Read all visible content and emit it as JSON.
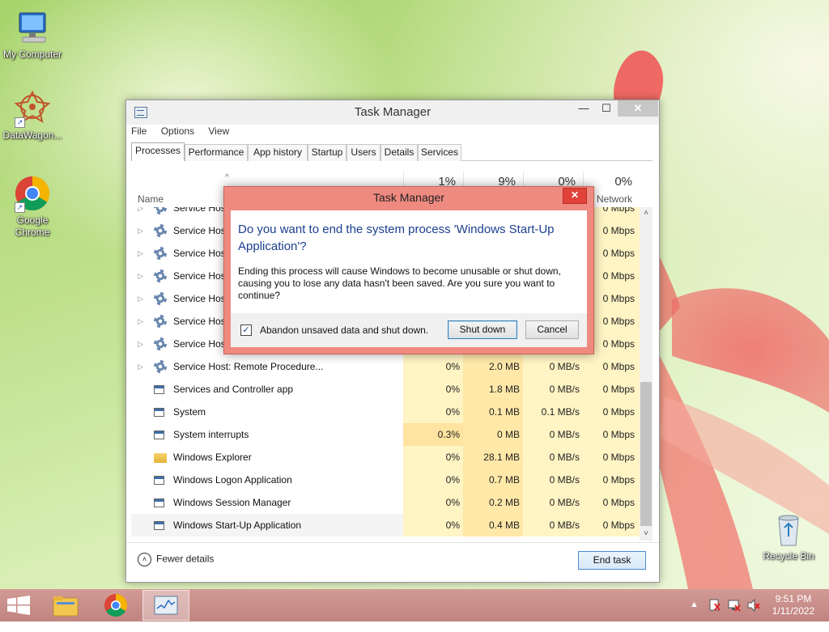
{
  "desktop": {
    "icons": [
      {
        "label": "My Computer",
        "icon": "computer-icon"
      },
      {
        "label": "DataWagon...",
        "icon": "datawagon-icon"
      },
      {
        "label": "Google Chrome",
        "icon": "chrome-icon"
      },
      {
        "label": "Recycle Bin",
        "icon": "recycle-bin-icon"
      }
    ]
  },
  "task_manager": {
    "title": "Task Manager",
    "window_buttons": {
      "minimize": "—",
      "maximize": "☐",
      "close": "✕"
    },
    "menu": [
      "File",
      "Options",
      "View"
    ],
    "tabs": [
      "Processes",
      "Performance",
      "App history",
      "Startup",
      "Users",
      "Details",
      "Services"
    ],
    "active_tab": "Processes",
    "columns": {
      "name": "Name",
      "sort_arrow": "^",
      "cpu_pct": "1%",
      "memory_pct": "9%",
      "disk_pct": "0%",
      "network_pct": "0%",
      "network_label": "Network"
    },
    "rows": [
      {
        "name": "Service Host",
        "expand": "▷",
        "icon": "gear",
        "cpu": "",
        "mem": "",
        "disk": "",
        "net": "0 Mbps"
      },
      {
        "name": "Service Host",
        "expand": "▷",
        "icon": "gear",
        "cpu": "",
        "mem": "",
        "disk": "",
        "net": "0 Mbps"
      },
      {
        "name": "Service Host",
        "expand": "▷",
        "icon": "gear",
        "cpu": "",
        "mem": "",
        "disk": "",
        "net": "0 Mbps"
      },
      {
        "name": "Service Host",
        "expand": "▷",
        "icon": "gear",
        "cpu": "",
        "mem": "",
        "disk": "",
        "net": "0 Mbps"
      },
      {
        "name": "Service Host",
        "expand": "▷",
        "icon": "gear",
        "cpu": "",
        "mem": "",
        "disk": "",
        "net": "0 Mbps"
      },
      {
        "name": "Service Host",
        "expand": "▷",
        "icon": "gear",
        "cpu": "",
        "mem": "",
        "disk": "",
        "net": "0 Mbps"
      },
      {
        "name": "Service Host",
        "expand": "▷",
        "icon": "gear",
        "cpu": "",
        "mem": "",
        "disk": "",
        "net": "0 Mbps"
      },
      {
        "name": "Service Host: Remote Procedure...",
        "expand": "▷",
        "icon": "gear",
        "cpu": "0%",
        "mem": "2.0 MB",
        "disk": "0 MB/s",
        "net": "0 Mbps"
      },
      {
        "name": "Services and Controller app",
        "expand": "",
        "icon": "window",
        "cpu": "0%",
        "mem": "1.8 MB",
        "disk": "0 MB/s",
        "net": "0 Mbps"
      },
      {
        "name": "System",
        "expand": "",
        "icon": "window",
        "cpu": "0%",
        "mem": "0.1 MB",
        "disk": "0.1 MB/s",
        "net": "0 Mbps"
      },
      {
        "name": "System interrupts",
        "expand": "",
        "icon": "window",
        "cpu": "0.3%",
        "mem": "0 MB",
        "disk": "0 MB/s",
        "net": "0 Mbps"
      },
      {
        "name": "Windows Explorer",
        "expand": "",
        "icon": "folder",
        "cpu": "0%",
        "mem": "28.1 MB",
        "disk": "0 MB/s",
        "net": "0 Mbps"
      },
      {
        "name": "Windows Logon Application",
        "expand": "",
        "icon": "window",
        "cpu": "0%",
        "mem": "0.7 MB",
        "disk": "0 MB/s",
        "net": "0 Mbps"
      },
      {
        "name": "Windows Session Manager",
        "expand": "",
        "icon": "window",
        "cpu": "0%",
        "mem": "0.2 MB",
        "disk": "0 MB/s",
        "net": "0 Mbps"
      },
      {
        "name": "Windows Start-Up Application",
        "expand": "",
        "icon": "window",
        "cpu": "0%",
        "mem": "0.4 MB",
        "disk": "0 MB/s",
        "net": "0 Mbps"
      }
    ],
    "selected_row": "Windows Start-Up Application",
    "scrollbar": {
      "up": "˄",
      "down": "˅"
    },
    "footer": {
      "fewer_details": "Fewer details",
      "fewer_icon": "˄",
      "end_task": "End task"
    }
  },
  "dialog": {
    "title": "Task Manager",
    "close": "✕",
    "question": "Do you want to end the system process 'Windows Start-Up Application'?",
    "message": "Ending this process will cause Windows to become unusable or shut down, causing you to lose any data hasn't been saved. Are you sure you want to continue?",
    "checkbox_label": "Abandon unsaved data and shut down.",
    "checkbox_checked": true,
    "checkmark": "✓",
    "primary_button": "Shut down",
    "cancel_button": "Cancel"
  },
  "taskbar": {
    "apps": [
      "file-explorer-icon",
      "chrome-icon",
      "task-manager-icon"
    ],
    "active_app": "task-manager-icon",
    "tray_arrow": "▲",
    "time": "9:51 PM",
    "date": "1/11/2022"
  },
  "colors": {
    "dialog_border": "#ee8a80",
    "question_text": "#1c3f8f",
    "heat_cell": "#fff4c4",
    "taskbar": "#c98e8a"
  }
}
